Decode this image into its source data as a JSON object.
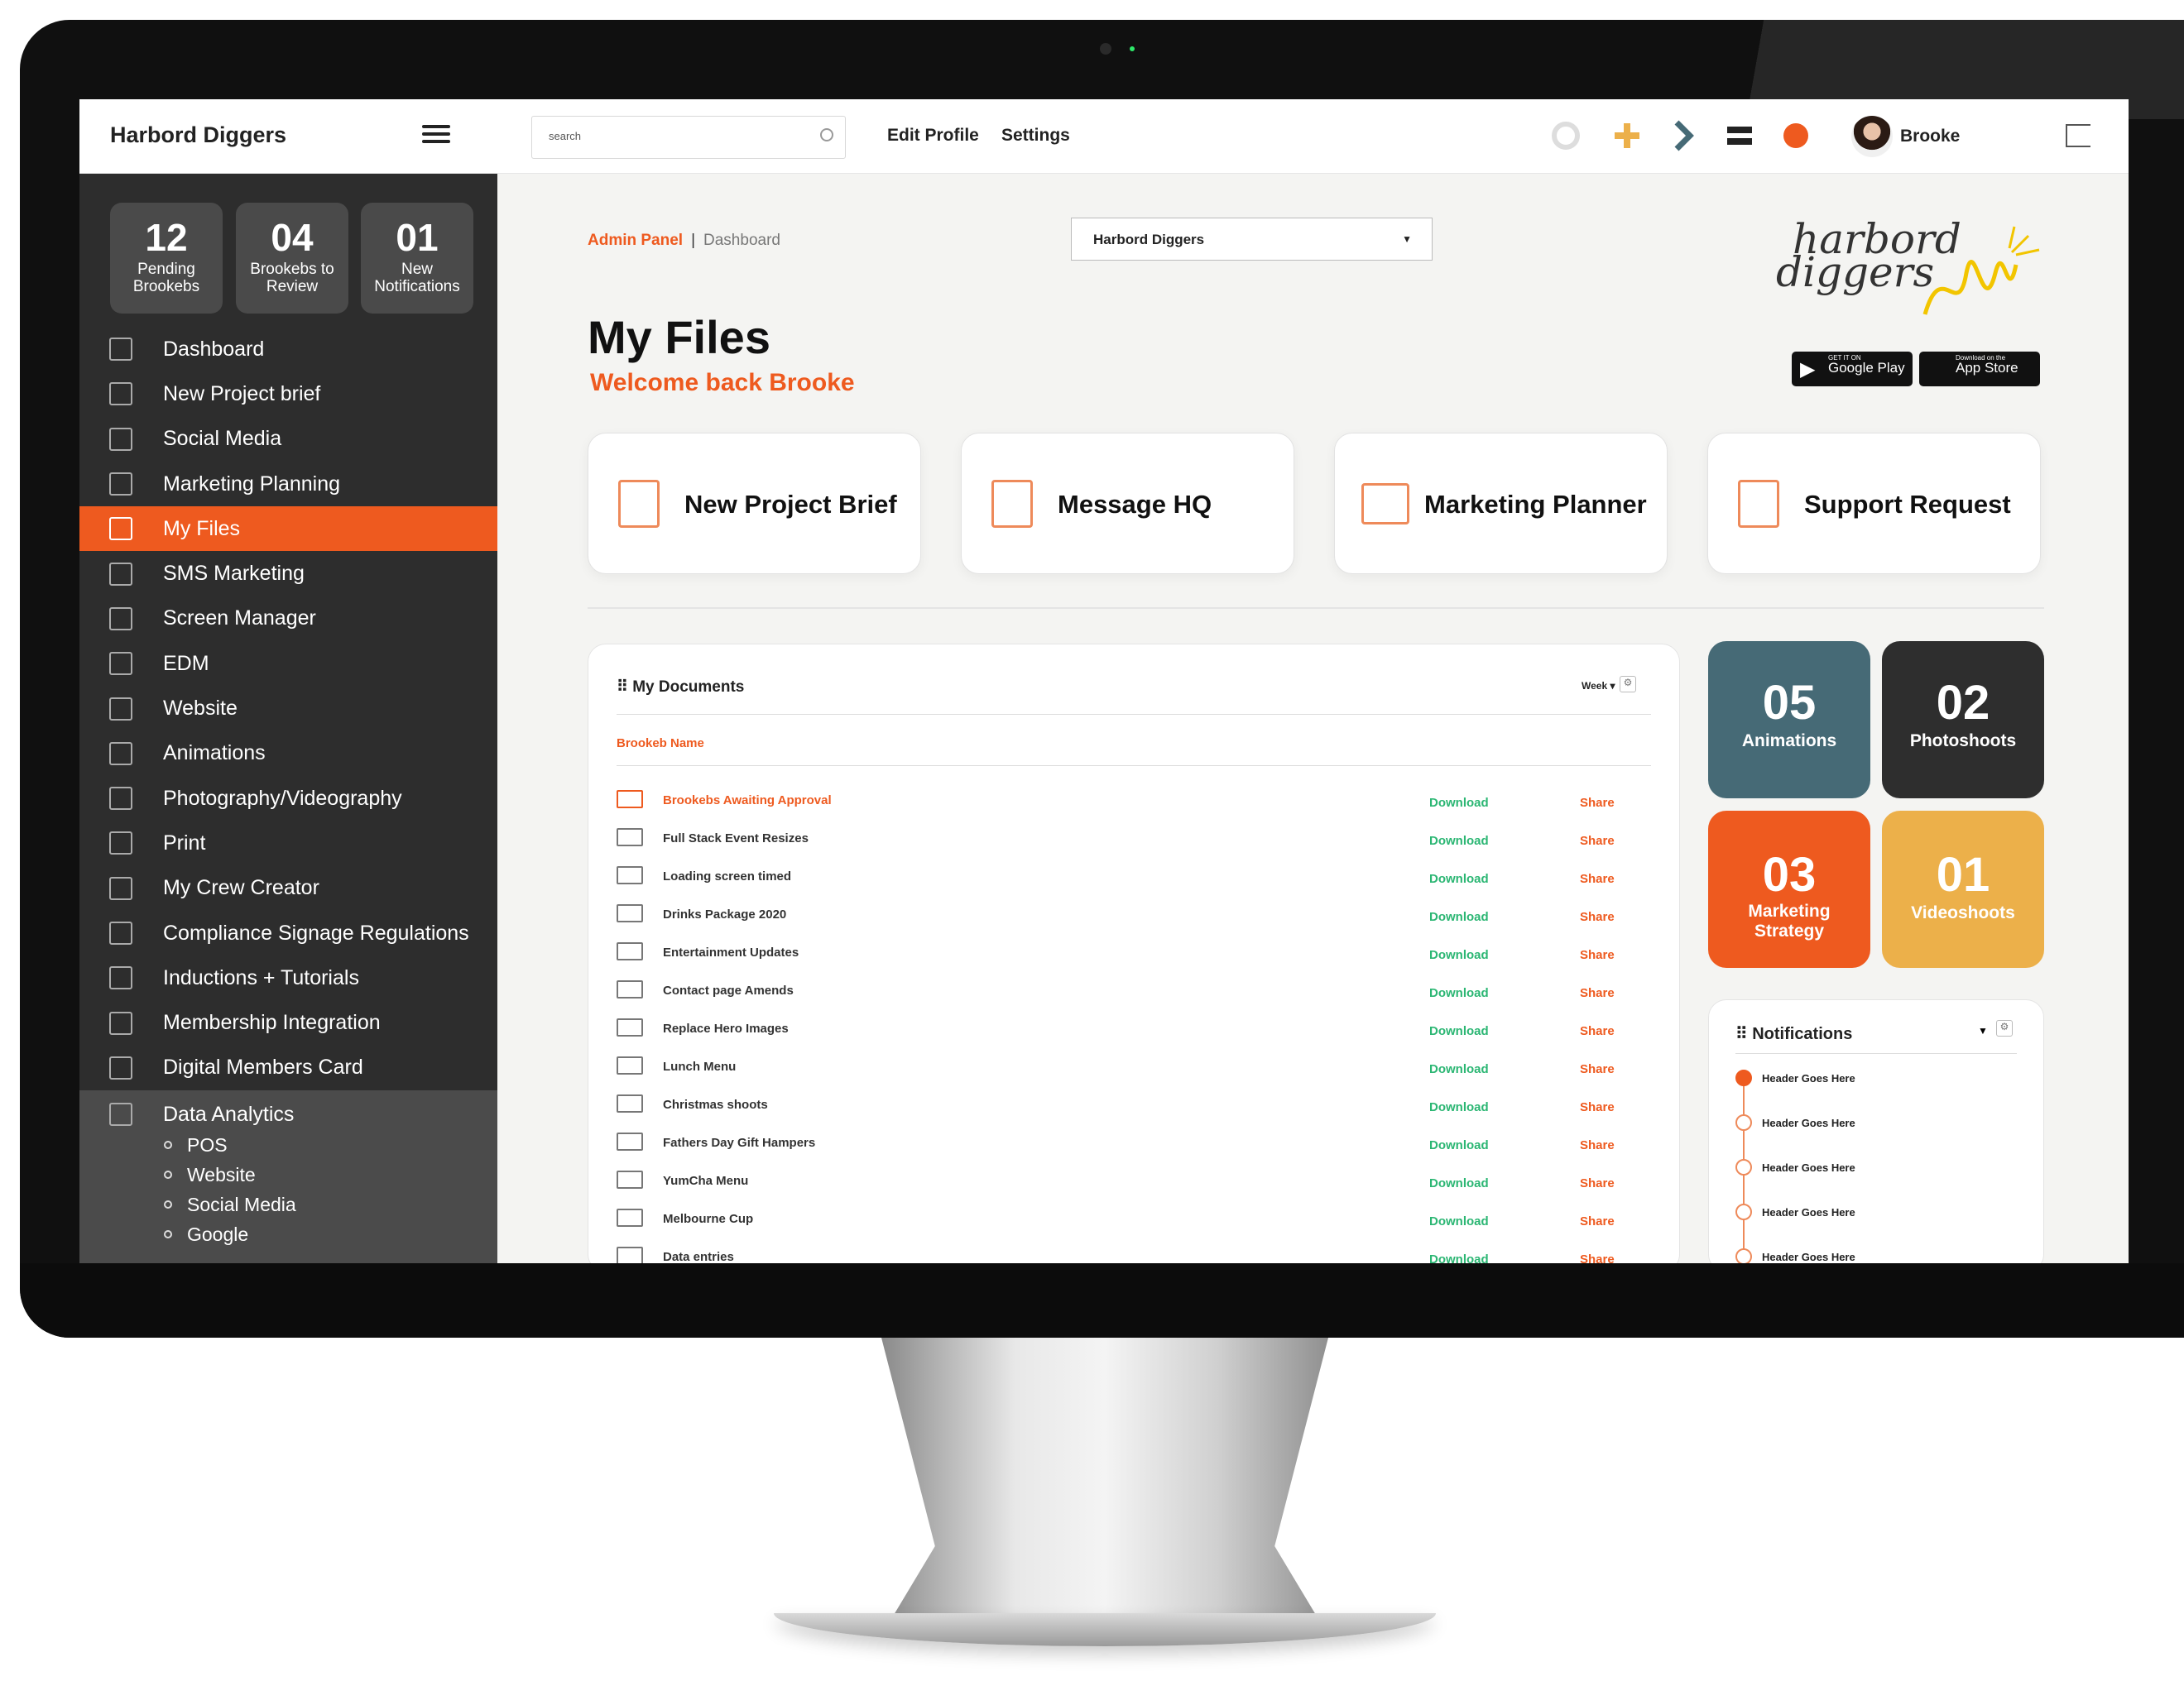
{
  "header": {
    "brand": "Harbord Diggers",
    "search_placeholder": "search",
    "edit_profile": "Edit Profile",
    "settings": "Settings",
    "username": "Brooke"
  },
  "stats": [
    {
      "number": "12",
      "label": "Pending Brookebs"
    },
    {
      "number": "04",
      "label": "Brookebs to Review"
    },
    {
      "number": "01",
      "label": "New Notifications"
    }
  ],
  "sidebar": {
    "items": [
      {
        "label": "Dashboard",
        "icon": "dashboard-icon"
      },
      {
        "label": "New Project brief",
        "icon": "document-icon"
      },
      {
        "label": "Social Media",
        "icon": "thumbs-up-icon"
      },
      {
        "label": "Marketing Planning",
        "icon": "calendar-icon"
      },
      {
        "label": "My Files",
        "icon": "files-icon",
        "active": true
      },
      {
        "label": "SMS Marketing",
        "icon": "bar-chart-icon"
      },
      {
        "label": "Screen Manager",
        "icon": "screen-icon"
      },
      {
        "label": "EDM",
        "icon": "email-icon"
      },
      {
        "label": "Website",
        "icon": "monitor-icon"
      },
      {
        "label": "Animations",
        "icon": "image-icon"
      },
      {
        "label": "Photography/Videography",
        "icon": "film-icon"
      },
      {
        "label": "Print",
        "icon": "print-icon"
      },
      {
        "label": "My Crew Creator",
        "icon": "clapper-icon"
      },
      {
        "label": "Compliance Signage Regulations",
        "icon": "checkbox-icon"
      },
      {
        "label": "Inductions + Tutorials",
        "icon": "tutorial-icon"
      },
      {
        "label": "Membership Integration",
        "icon": "grid-icon"
      },
      {
        "label": "Digital Members Card",
        "icon": "card-icon"
      },
      {
        "label": "Data Analytics",
        "icon": "analytics-icon"
      }
    ],
    "sub_items": [
      "POS",
      "Website",
      "Social Media",
      "Google"
    ]
  },
  "breadcrumb": {
    "root": "Admin Panel",
    "current": "Dashboard"
  },
  "venue_select": "Harbord Diggers",
  "page": {
    "title": "My Files",
    "welcome": "Welcome back Brooke"
  },
  "logo": {
    "line1": "harbord",
    "line2": "diggers"
  },
  "store_badges": {
    "google_small": "GET IT ON",
    "google": "Google Play",
    "apple_small": "Download on the",
    "apple": "App Store"
  },
  "quick_actions": [
    {
      "label": "New Project Brief",
      "icon": "edit-icon"
    },
    {
      "label": "Message HQ",
      "icon": "edit-icon"
    },
    {
      "label": "Marketing Planner",
      "icon": "folder-icon"
    },
    {
      "label": "Support Request",
      "icon": "binder-icon"
    }
  ],
  "documents": {
    "title": "My Documents",
    "period": "Week",
    "column": "Brookeb Name",
    "download_label": "Download",
    "share_label": "Share",
    "rows": [
      {
        "name": "Brookebs Awaiting Approval",
        "highlight": true
      },
      {
        "name": "Full Stack Event Resizes"
      },
      {
        "name": "Loading screen timed"
      },
      {
        "name": "Drinks Package 2020"
      },
      {
        "name": "Entertainment Updates"
      },
      {
        "name": "Contact page Amends"
      },
      {
        "name": "Replace Hero Images"
      },
      {
        "name": "Lunch Menu"
      },
      {
        "name": "Christmas shoots"
      },
      {
        "name": "Fathers Day Gift Hampers"
      },
      {
        "name": "YumCha Menu"
      },
      {
        "name": "Melbourne Cup"
      },
      {
        "name": "Data entries"
      }
    ]
  },
  "tiles": [
    {
      "number": "05",
      "label": "Animations",
      "color": "#466a76"
    },
    {
      "number": "02",
      "label": "Photoshoots",
      "color": "#2e2e2e"
    },
    {
      "number": "03",
      "label": "Marketing Strategy",
      "color": "#ee5a1f"
    },
    {
      "number": "01",
      "label": "Videoshoots",
      "color": "#ecb04a"
    }
  ],
  "notifications": {
    "title": "Notifications",
    "items": [
      "Header Goes Here",
      "Header Goes Here",
      "Header Goes Here",
      "Header Goes Here",
      "Header Goes Here"
    ]
  },
  "colors": {
    "accent": "#ee5a1f",
    "sidebar": "#2d2d2d",
    "download": "#2bb673"
  }
}
